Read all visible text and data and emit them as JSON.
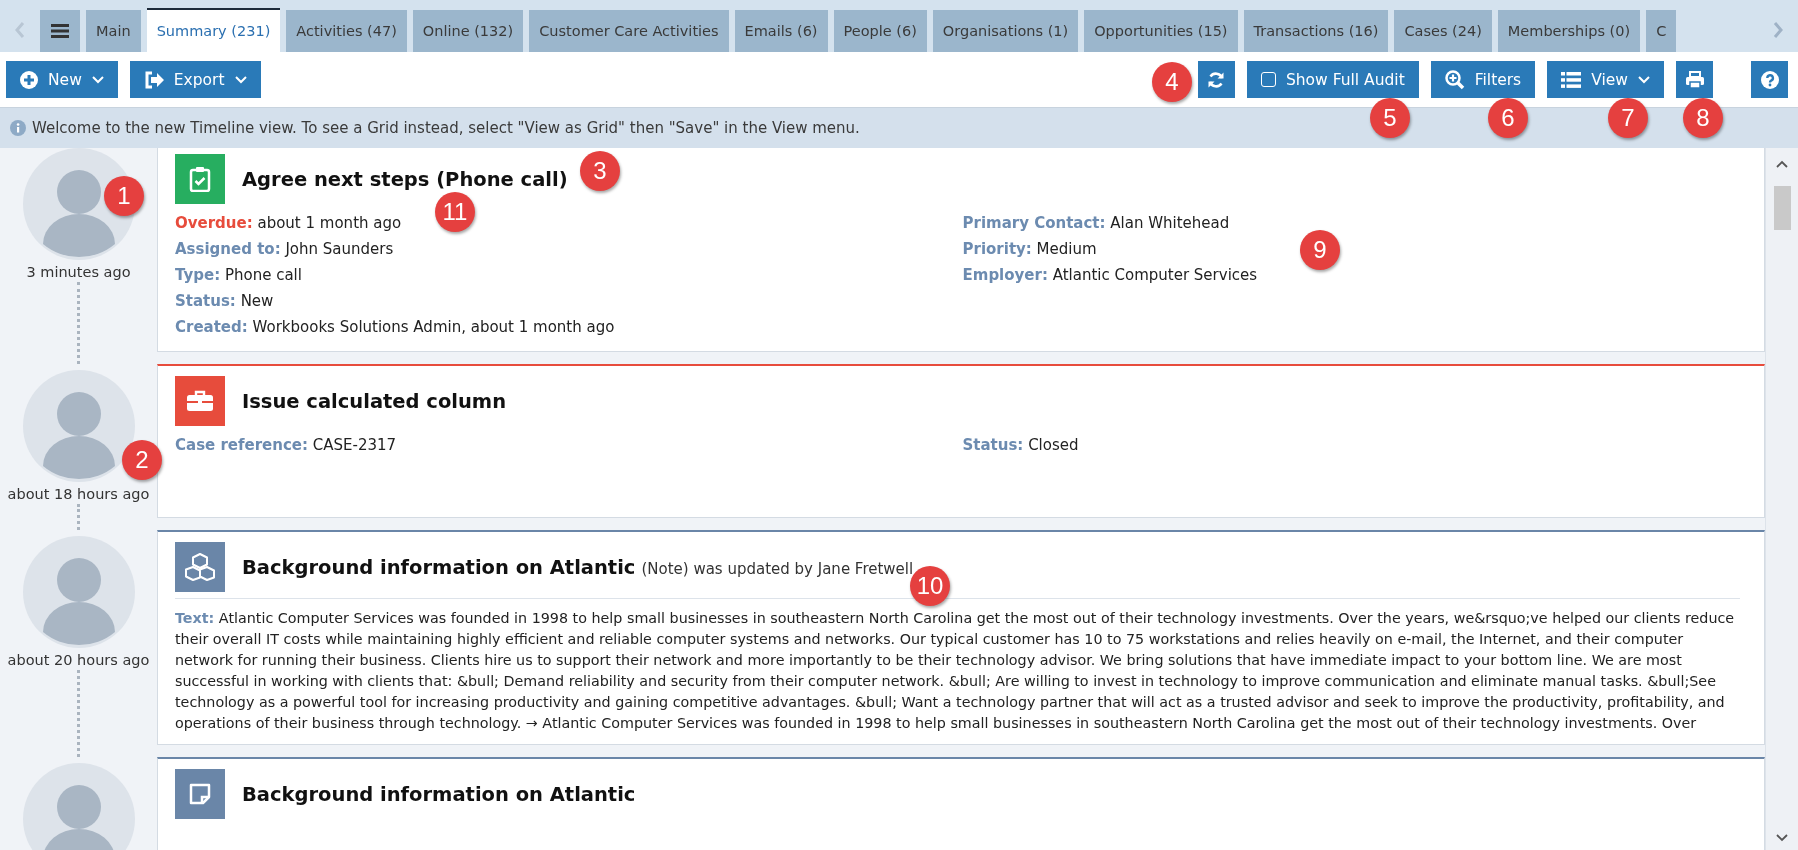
{
  "tab_bar": {
    "tabs": [
      {
        "label": "Main",
        "selected": false
      },
      {
        "label": "Summary (231)",
        "selected": true
      },
      {
        "label": "Activities (47)",
        "selected": false
      },
      {
        "label": "Online (132)",
        "selected": false
      },
      {
        "label": "Customer Care Activities",
        "selected": false
      },
      {
        "label": "Emails (6)",
        "selected": false
      },
      {
        "label": "People (6)",
        "selected": false
      },
      {
        "label": "Organisations (1)",
        "selected": false
      },
      {
        "label": "Opportunities (15)",
        "selected": false
      },
      {
        "label": "Transactions (16)",
        "selected": false
      },
      {
        "label": "Cases (24)",
        "selected": false
      },
      {
        "label": "Memberships (0)",
        "selected": false
      },
      {
        "label": "C",
        "selected": false
      }
    ]
  },
  "toolbar": {
    "left_buttons": [
      {
        "kind": "new",
        "label": "New"
      },
      {
        "kind": "export",
        "label": "Export"
      }
    ],
    "right_buttons": [
      {
        "kind": "refresh"
      },
      {
        "kind": "audit",
        "label": "Show Full Audit",
        "checked": false
      },
      {
        "kind": "filters",
        "label": "Filters"
      },
      {
        "kind": "view",
        "label": "View"
      },
      {
        "kind": "print"
      },
      {
        "kind": "help"
      }
    ]
  },
  "info_bar": {
    "message": "Welcome to the new Timeline view. To see a Grid instead, select \"View as Grid\" then \"Save\" in the View menu."
  },
  "timeline": [
    {
      "kind": "task",
      "color": "#27ae60",
      "time": "3 minutes ago",
      "title": "Agree next steps (Phone call)",
      "left_fields": [
        {
          "label": "Overdue:",
          "value": "about 1 month ago",
          "overdue": true
        },
        {
          "label": "Assigned to:",
          "value": "John Saunders",
          "overdue": false
        },
        {
          "label": "Type:",
          "value": "Phone call",
          "overdue": false
        },
        {
          "label": "Status:",
          "value": "New",
          "overdue": false
        },
        {
          "label": "Created:",
          "value": "Workbooks Solutions Admin, about 1 month ago",
          "overdue": false
        }
      ],
      "right_fields": [
        {
          "label": "Primary Contact:",
          "value": "Alan Whitehead",
          "overdue": false
        },
        {
          "label": "Priority:",
          "value": "Medium",
          "overdue": false
        },
        {
          "label": "Employer:",
          "value": "Atlantic Computer Services",
          "overdue": false
        }
      ]
    },
    {
      "kind": "case",
      "color": "#e74c3c",
      "time": "about 18 hours ago",
      "title": "Issue calculated column",
      "left_fields": [
        {
          "label": "Case reference:",
          "value": "CASE-2317",
          "overdue": false
        }
      ],
      "right_fields": [
        {
          "label": "Status:",
          "value": "Closed",
          "overdue": false
        }
      ]
    },
    {
      "kind": "update",
      "color": "#6a86a8",
      "time": "about 20 hours ago",
      "title": "Background information on Atlantic",
      "subtitle": "(Note) was updated by Jane Fretwell",
      "text_label": "Text:",
      "text": "Atlantic Computer Services was founded in 1998 to help small businesses in southeastern North Carolina get the most out of their technology investments. Over the years, we&rsquo;ve helped our clients reduce their overall IT costs while maintaining highly efficient and reliable computer systems and networks. Our typical customer has 10 to 75 workstations and relies heavily on e-mail, the Internet, and their computer network for running their business. Clients hire us to support their network and more importantly to be their technology advisor. We bring solutions that have immediate impact to your bottom line. We are most successful in working with clients that: &bull; Demand reliability and security from their computer network. &bull; Are willing to invest in technology to improve communication and eliminate manual tasks. &bull;See technology as a powerful tool for increasing productivity and gaining competitive advantages. &bull; Want a technology partner that will act as a trusted advisor and seek to improve the productivity, profitability, and operations of their business through technology. → Atlantic Computer Services was founded in 1998 to help small businesses in southeastern North Carolina get the most out of their technology investments. Over"
    },
    {
      "kind": "note",
      "color": "#6a86a8",
      "title": "Background information on Atlantic"
    }
  ],
  "callouts": [
    "1",
    "2",
    "3",
    "4",
    "5",
    "6",
    "7",
    "8",
    "9",
    "10",
    "11"
  ]
}
